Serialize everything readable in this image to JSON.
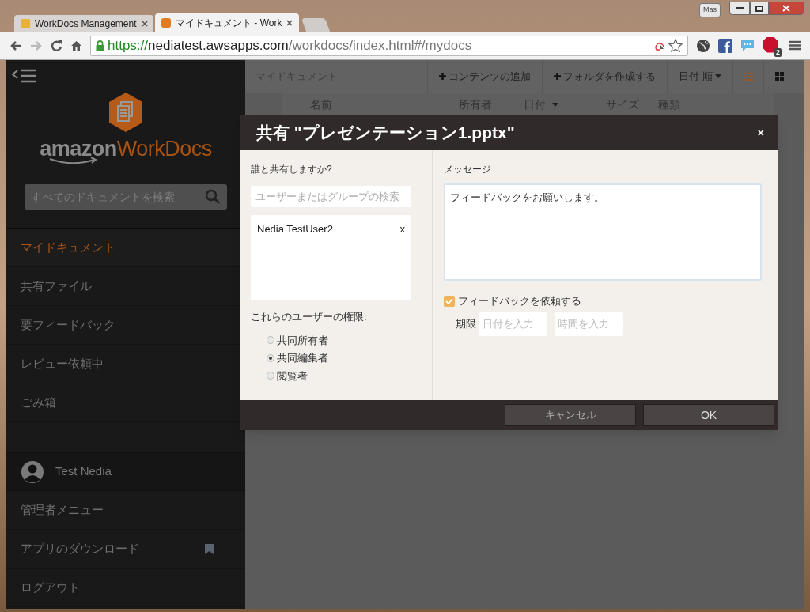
{
  "browser": {
    "user_badge": "Mas",
    "tabs": [
      {
        "label": "WorkDocs Management",
        "selected": false
      },
      {
        "label": "マイドキュメント - Work",
        "selected": true
      }
    ],
    "url": {
      "scheme": "https://",
      "host": "nediatest.awsapps.com",
      "path": "/workdocs/index.html#/mydocs"
    },
    "abp_count": "2"
  },
  "sidebar": {
    "logo_left": "amazon",
    "logo_right": "WorkDocs",
    "search": {
      "placeholder": "すべてのドキュメントを検索"
    },
    "items": [
      {
        "label": "マイドキュメント",
        "selected": true
      },
      {
        "label": "共有ファイル",
        "selected": false
      },
      {
        "label": "要フィードバック",
        "selected": false
      },
      {
        "label": "レビュー依頼中",
        "selected": false
      },
      {
        "label": "ごみ箱",
        "selected": false
      }
    ],
    "user": "Test Nedia",
    "bottom_items": [
      {
        "label": "管理者メニュー",
        "kind": "plain"
      },
      {
        "label": "アプリのダウンロード",
        "kind": "bookmark"
      },
      {
        "label": "ログアウト",
        "kind": "plain"
      }
    ]
  },
  "toolbar": {
    "breadcrumb": "マイドキュメント",
    "buttons": [
      "コンテンツの追加",
      "フォルダを作成する"
    ],
    "sort": "日付 順",
    "views": [
      {
        "kind": "list",
        "selected": true
      },
      {
        "kind": "grid",
        "selected": false
      }
    ]
  },
  "table": {
    "columns": [
      {
        "label": "名前",
        "sorted": false
      },
      {
        "label": "所有者",
        "sorted": false
      },
      {
        "label": "日付",
        "sorted": true
      },
      {
        "label": "サイズ",
        "sorted": false
      },
      {
        "label": "種類",
        "sorted": false
      }
    ]
  },
  "dialog": {
    "title": "共有 \"プレゼンテーション1.pptx\"",
    "close": "×",
    "who_label": "誰と共有しますか?",
    "user_search": {
      "placeholder": "ユーザーまたはグループの検索"
    },
    "recipients": [
      {
        "name": "Nedia TestUser2",
        "remove": "x"
      }
    ],
    "permissions_label": "これらのユーザーの権限:",
    "permissions": [
      {
        "label": "共同所有者",
        "selected": false
      },
      {
        "label": "共同編集者",
        "selected": true
      },
      {
        "label": "閲覧者",
        "selected": false
      }
    ],
    "message_label": "メッセージ",
    "message": "フィードバックをお願いします。",
    "request_feedback": {
      "label": "フィードバックを依頼する",
      "checked": true
    },
    "deadline_label": "期限",
    "date": {
      "placeholder": "日付を入力"
    },
    "time": {
      "placeholder": "時間を入力"
    },
    "buttons": [
      {
        "label": "キャンセル",
        "kind": "secondary"
      },
      {
        "label": "OK",
        "kind": "primary"
      }
    ]
  }
}
